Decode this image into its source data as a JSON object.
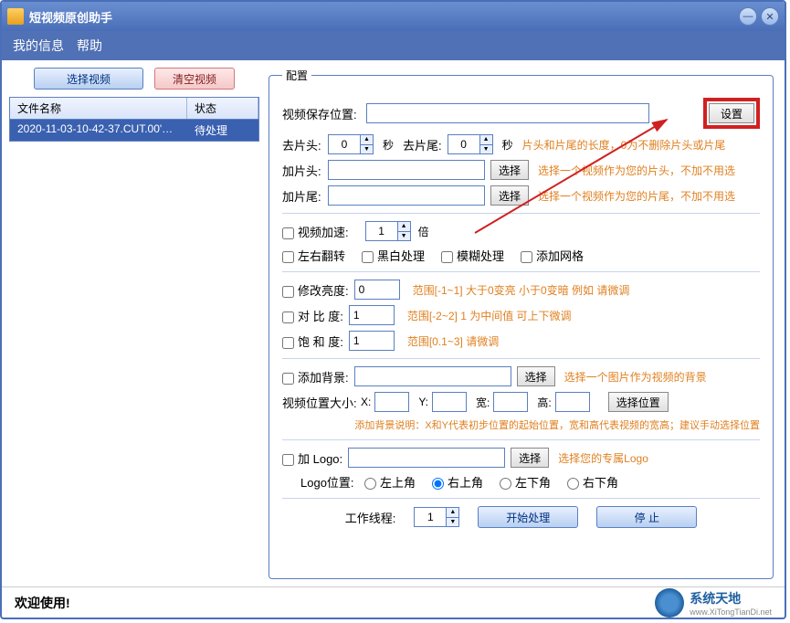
{
  "window": {
    "title": "短视频原创助手"
  },
  "menu": {
    "info": "我的信息",
    "help": "帮助"
  },
  "left": {
    "select_video": "选择视频",
    "clear_video": "清空视频",
    "col_name": "文件名称",
    "col_status": "状态",
    "row_name": "2020-11-03-10-42-37.CUT.00'…",
    "row_status": "待处理"
  },
  "cfg": {
    "legend": "配置",
    "save_loc_lbl": "视频保存位置:",
    "save_loc": "",
    "set_btn": "设置",
    "trim_head_lbl": "去片头:",
    "trim_head_val": "0",
    "sec1": "秒",
    "trim_tail_lbl": "去片尾:",
    "trim_tail_val": "0",
    "sec2": "秒",
    "trim_tip": "片头和片尾的长度，0为不删除片头或片尾",
    "add_head_lbl": "加片头:",
    "add_head_val": "",
    "choose": "选择",
    "add_head_tip": "选择一个视频作为您的片头，不加不用选",
    "add_tail_lbl": "加片尾:",
    "add_tail_val": "",
    "add_tail_tip": "选择一个视频作为您的片尾，不加不用选",
    "speed_chk": "视频加速:",
    "speed_val": "1",
    "speed_unit": "倍",
    "flip_chk": "左右翻转",
    "bw_chk": "黑白处理",
    "blur_chk": "模糊处理",
    "grid_chk": "添加网格",
    "bright_chk": "修改亮度:",
    "bright_val": "0",
    "bright_tip": "范围[-1~1]    大于0变亮 小于0变暗  例如 请微调",
    "contrast_chk": "对 比  度:",
    "contrast_val": "1",
    "contrast_tip": "范围[-2~2]   1 为中间值  可上下微调",
    "sat_chk": "饱 和  度:",
    "sat_val": "1",
    "sat_tip": "范围[0.1~3]   请微调",
    "bg_chk": "添加背景:",
    "bg_val": "",
    "bg_tip": "选择一个图片作为视频的背景",
    "pos_lbl": "视频位置大小:",
    "x_lbl": "X:",
    "y_lbl": "Y:",
    "w_lbl": "宽:",
    "h_lbl": "高:",
    "pos_btn": "选择位置",
    "bg_note": "添加背景说明：X和Y代表初步位置的起始位置，宽和高代表视频的宽高；建议手动选择位置",
    "logo_chk": "加 Logo:",
    "logo_val": "",
    "logo_tip": "选择您的专属Logo",
    "logo_pos_lbl": "Logo位置:",
    "pos_tl": "左上角",
    "pos_tr": "右上角",
    "pos_bl": "左下角",
    "pos_br": "右下角",
    "threads_lbl": "工作线程:",
    "threads_val": "1",
    "start_btn": "开始处理",
    "stop_btn": "停    止"
  },
  "footer": {
    "welcome": "欢迎使用!",
    "brand": "系统天地",
    "brand_url": "www.XiTongTianDi.net"
  }
}
